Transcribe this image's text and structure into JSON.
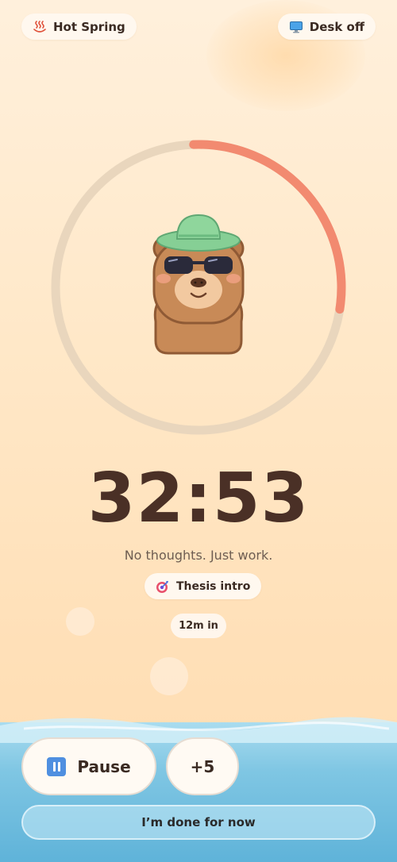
{
  "header": {
    "location": {
      "icon": "hot-spring-icon",
      "label": "Hot Spring"
    },
    "desk": {
      "icon": "monitor-icon",
      "label": "Desk off"
    }
  },
  "timer": {
    "time": "32:53",
    "progress_fraction": 0.28,
    "ring_track_color": "#e9d6bd",
    "ring_progress_color": "#f28a70"
  },
  "motto": "No thoughts. Just work.",
  "task": {
    "icon": "target-icon",
    "label": "Thesis intro"
  },
  "elapsed": "12m in",
  "controls": {
    "pause_label": "Pause",
    "pause_icon": "pause-icon",
    "add_time_label": "+5",
    "done_label": "I’m done for now"
  },
  "colors": {
    "accent": "#f28a70",
    "text": "#4a3026",
    "water": "#7fc6e3"
  }
}
